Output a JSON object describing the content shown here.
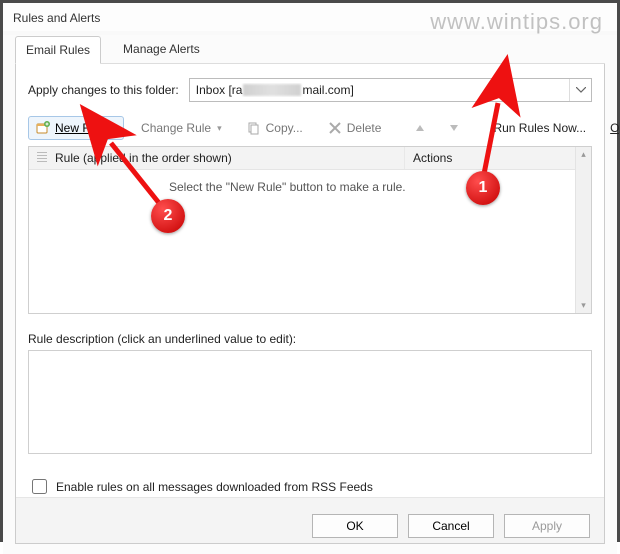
{
  "window": {
    "title": "Rules and Alerts"
  },
  "watermark": "www.wintips.org",
  "tabs": {
    "email_rules": "Email Rules",
    "manage_alerts": "Manage Alerts"
  },
  "folder": {
    "label": "Apply changes to this folder:",
    "value_prefix": "Inbox [ra",
    "value_suffix": "mail.com]"
  },
  "toolbar": {
    "new_rule": "New Rule...",
    "change_rule": "Change Rule",
    "copy": "Copy...",
    "delete": "Delete",
    "run_rules_now": "Run Rules Now...",
    "options": "Options"
  },
  "list": {
    "col_rule": "Rule (applied in the order shown)",
    "col_actions": "Actions",
    "empty_message": "Select the \"New Rule\" button to make a rule."
  },
  "description": {
    "label": "Rule description (click an underlined value to edit):"
  },
  "rss": {
    "label": "Enable rules on all messages downloaded from RSS Feeds"
  },
  "buttons": {
    "ok": "OK",
    "cancel": "Cancel",
    "apply": "Apply"
  },
  "annotations": {
    "badge1": "1",
    "badge2": "2"
  }
}
